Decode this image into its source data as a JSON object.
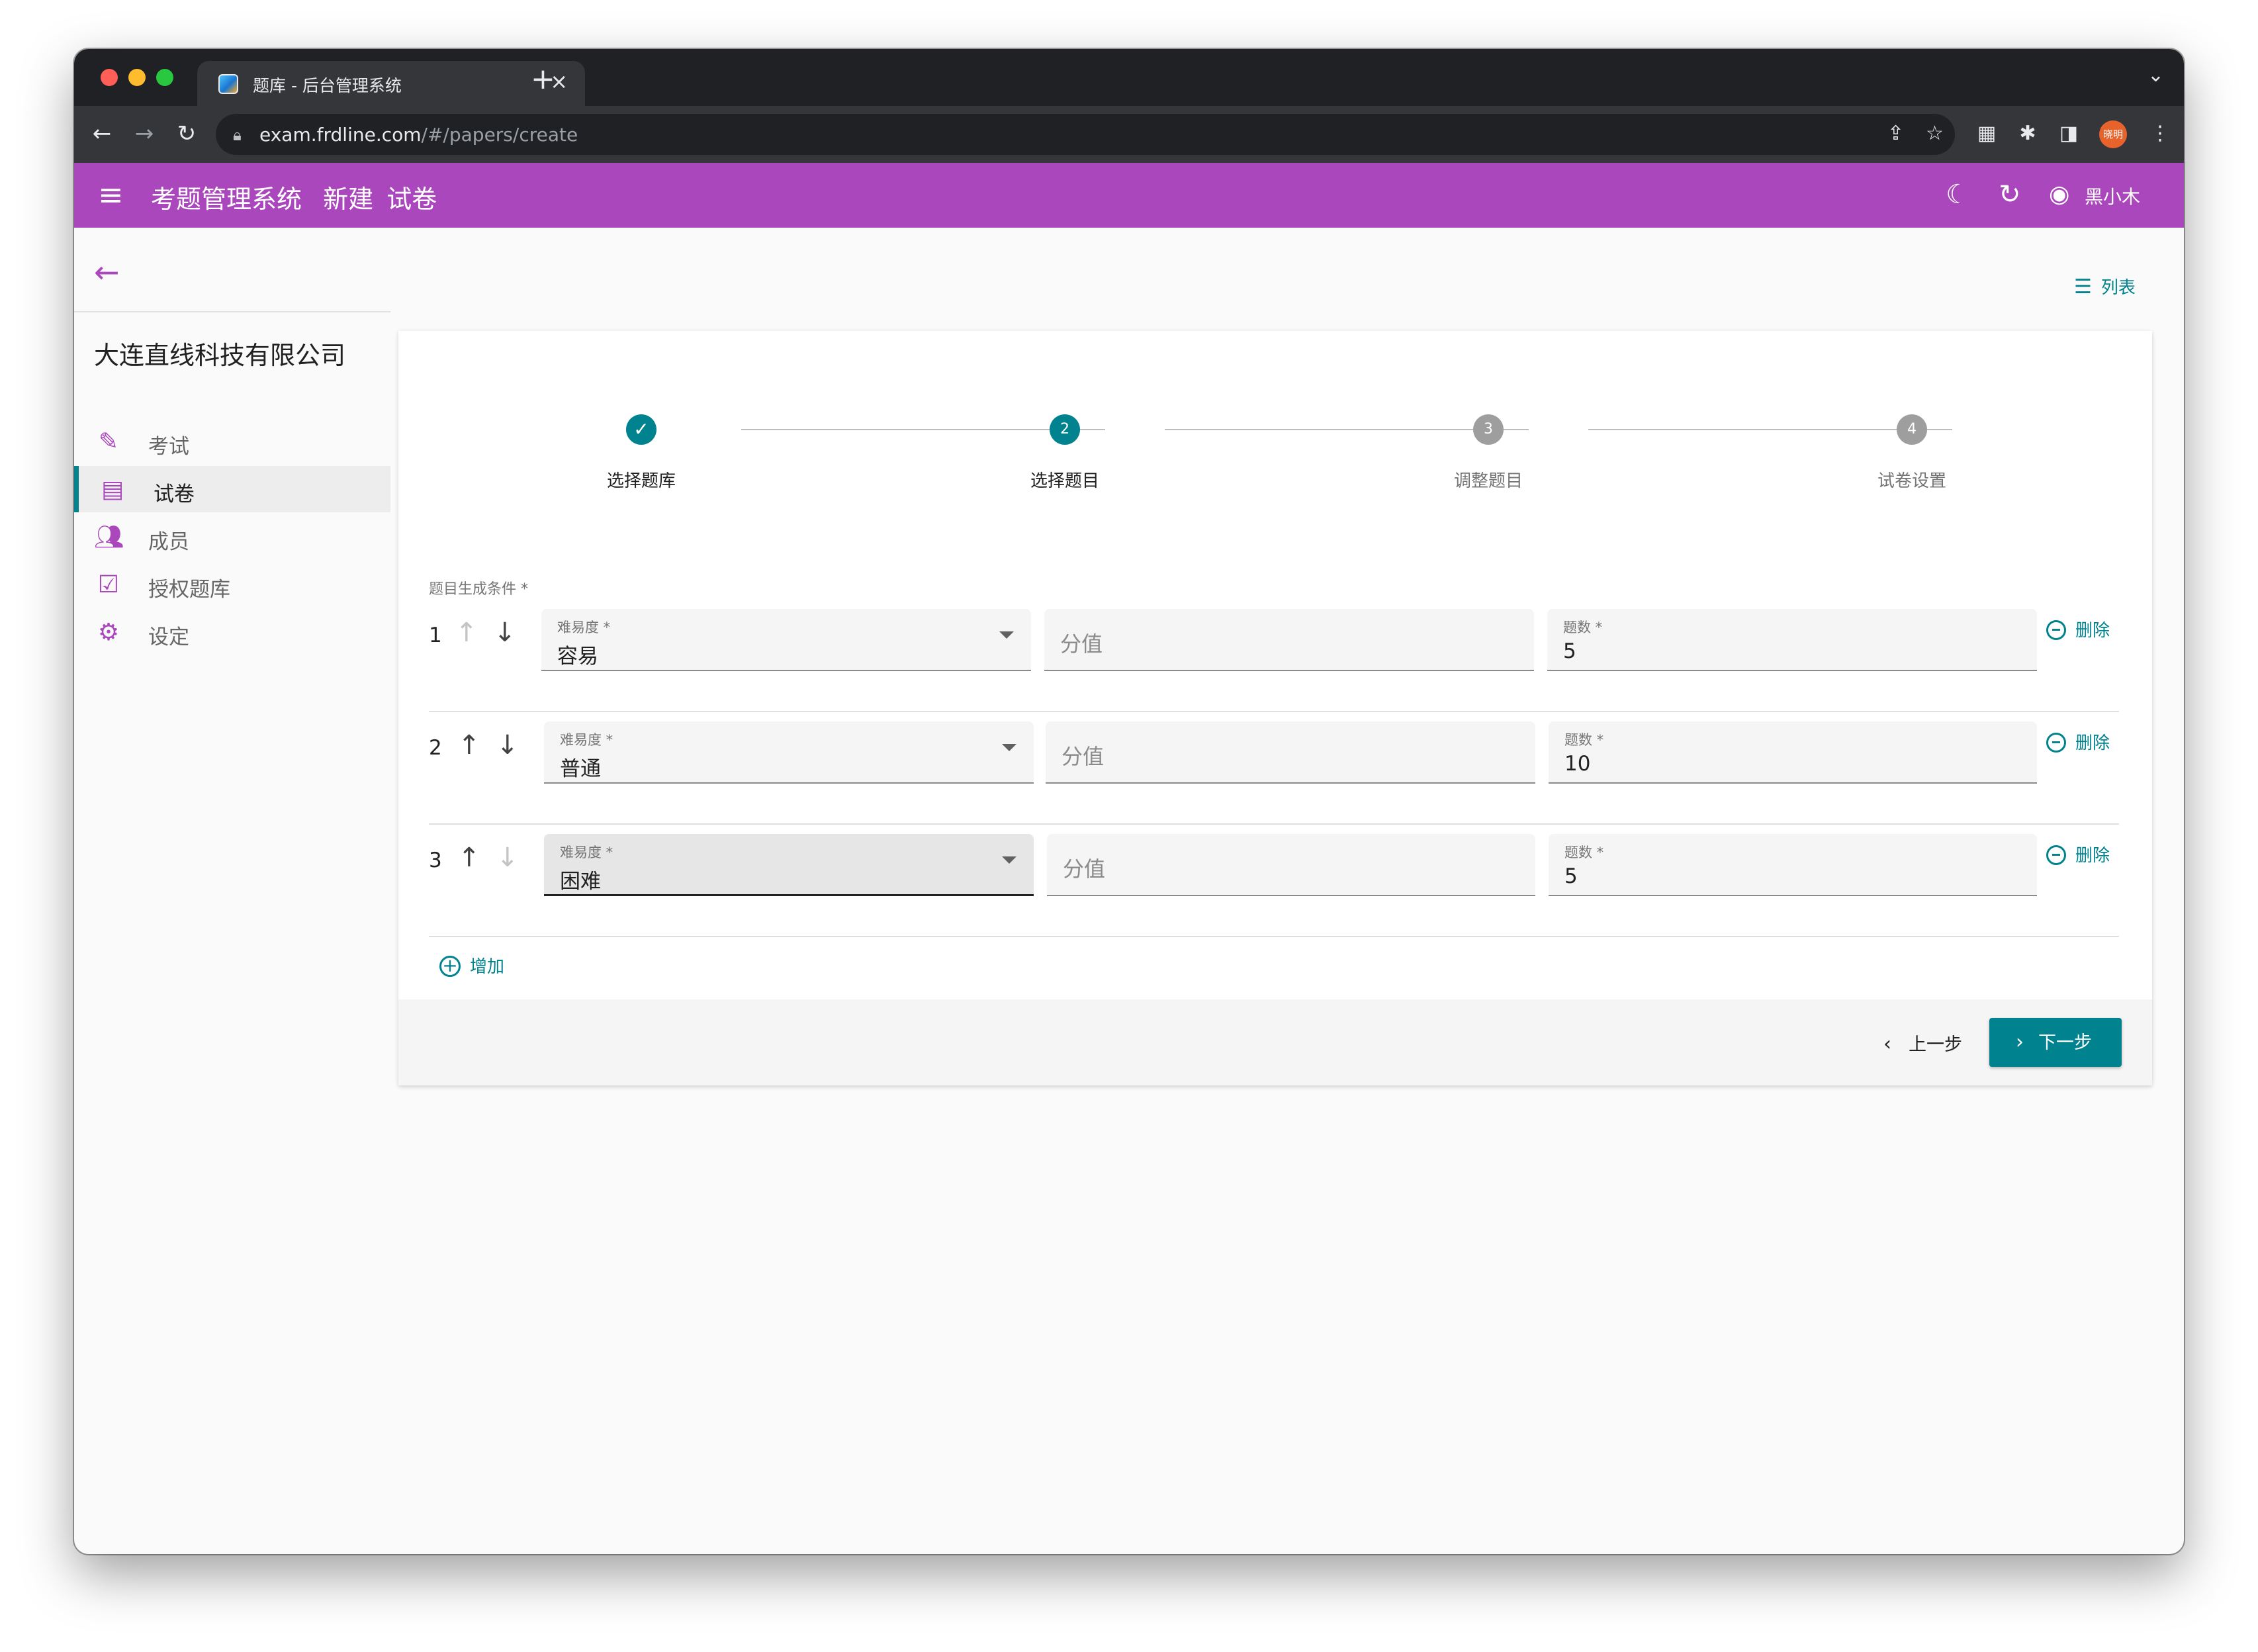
{
  "browser": {
    "tab_title": "题库 - 后台管理系统",
    "tab_close": "×",
    "new_tab": "+",
    "url_host": "exam.frdline.com",
    "url_path": "/#/papers/create",
    "avatar_text": "晓明"
  },
  "appbar": {
    "app_name": "考题管理系统",
    "crumb_1": "新建",
    "crumb_2": "试卷",
    "user_name": "黑小木"
  },
  "sidebar": {
    "company": "大连直线科技有限公司",
    "items": [
      {
        "label": "考试",
        "icon": "pencil-icon",
        "active": false
      },
      {
        "label": "试卷",
        "icon": "document-icon",
        "active": true
      },
      {
        "label": "成员",
        "icon": "people-icon",
        "active": false
      },
      {
        "label": "授权题库",
        "icon": "assignment-check-icon",
        "active": false
      },
      {
        "label": "设定",
        "icon": "gear-icon",
        "active": false
      }
    ]
  },
  "list_link": "列表",
  "stepper": {
    "steps": [
      {
        "label": "选择题库",
        "number": "1",
        "state": "completed"
      },
      {
        "label": "选择题目",
        "number": "2",
        "state": "active"
      },
      {
        "label": "调整题目",
        "number": "3",
        "state": "inactive"
      },
      {
        "label": "试卷设置",
        "number": "4",
        "state": "inactive"
      }
    ]
  },
  "form": {
    "conditions_label": "题目生成条件 *",
    "difficulty_label": "难易度 *",
    "score_placeholder": "分值",
    "count_label": "题数 *",
    "delete_label": "删除",
    "add_label": "增加",
    "rows": [
      {
        "index": "1",
        "difficulty": "容易",
        "count": "5",
        "up_disabled": true,
        "down_disabled": false
      },
      {
        "index": "2",
        "difficulty": "普通",
        "count": "10",
        "up_disabled": false,
        "down_disabled": false
      },
      {
        "index": "3",
        "difficulty": "困难",
        "count": "5",
        "up_disabled": false,
        "down_disabled": true,
        "focused": true
      }
    ]
  },
  "footer": {
    "prev_label": "上一步",
    "next_label": "下一步"
  },
  "colors": {
    "primary": "#ab47bc",
    "accent": "#00838f",
    "inactive_step": "#9e9e9e"
  }
}
